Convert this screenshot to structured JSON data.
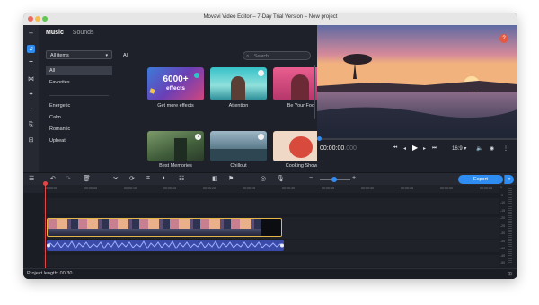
{
  "window": {
    "title": "Movavi Video Editor – 7-Day Trial Version – New project"
  },
  "left_toolbar": {
    "icons": [
      "add-icon",
      "music-icon",
      "titles-icon",
      "transitions-icon",
      "filters-icon",
      "stickers-icon",
      "export-preset-icon",
      "more-tools-icon"
    ]
  },
  "media_panel": {
    "tabs": [
      {
        "label": "Music",
        "active": true
      },
      {
        "label": "Sounds",
        "active": false
      }
    ],
    "filter_select": "All items",
    "categories": [
      "All",
      "Favorites",
      "Energetic",
      "Calm",
      "Romantic",
      "Upbeat"
    ],
    "selected_category": "All",
    "grid_header": "All",
    "search_placeholder": "Search",
    "promo_card": {
      "line1": "6000+",
      "line2": "effects"
    },
    "cards": [
      {
        "caption": "Get more effects"
      },
      {
        "caption": "Attention"
      },
      {
        "caption": "Be Your Fool"
      },
      {
        "caption": "Best Memories"
      },
      {
        "caption": "Chillout"
      },
      {
        "caption": "Cooking Show"
      }
    ]
  },
  "player": {
    "timecode_main": "00:00:00",
    "timecode_ms": ".000",
    "aspect": "16:9",
    "help_label": "?"
  },
  "timeline_toolbar": {
    "export_label": "Export"
  },
  "ruler": {
    "ticks": [
      "00:00:00",
      "00:00:05",
      "00:00:10",
      "00:00:15",
      "00:00:20",
      "00:00:25",
      "00:00:30",
      "00:00:35",
      "00:00:40",
      "00:00:45",
      "00:00:50",
      "00:00:55"
    ]
  },
  "meter": {
    "labels": [
      "0",
      "-5",
      "-10",
      "-15",
      "-20",
      "-25",
      "-30",
      "-35",
      "-40",
      "-45",
      "-50"
    ]
  },
  "status": {
    "project_length": "Project length: 00:30"
  },
  "colors": {
    "accent": "#2f8cf0",
    "playhead": "#e34646",
    "clip_border": "#e4b64a",
    "audio_wave": "#7f8fe0"
  }
}
